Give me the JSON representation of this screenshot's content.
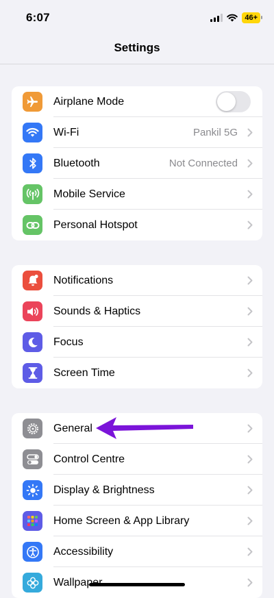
{
  "status_bar": {
    "time": "6:07",
    "battery": "46+"
  },
  "nav": {
    "title": "Settings"
  },
  "groups": [
    {
      "items": [
        {
          "label": "Airplane Mode",
          "icon": "airplane-icon",
          "color": "#f09a37",
          "toggle": false
        },
        {
          "label": "Wi-Fi",
          "icon": "wifi-icon",
          "color": "#3478f6",
          "value": "Pankil 5G"
        },
        {
          "label": "Bluetooth",
          "icon": "bluetooth-icon",
          "color": "#3478f6",
          "value": "Not Connected"
        },
        {
          "label": "Mobile Service",
          "icon": "antenna-icon",
          "color": "#65c466"
        },
        {
          "label": "Personal Hotspot",
          "icon": "link-icon",
          "color": "#65c466"
        }
      ]
    },
    {
      "items": [
        {
          "label": "Notifications",
          "icon": "bell-icon",
          "color": "#eb4e3d"
        },
        {
          "label": "Sounds & Haptics",
          "icon": "speaker-icon",
          "color": "#eb445a"
        },
        {
          "label": "Focus",
          "icon": "moon-icon",
          "color": "#5e5ce6"
        },
        {
          "label": "Screen Time",
          "icon": "hourglass-icon",
          "color": "#5e5ce6"
        }
      ]
    },
    {
      "items": [
        {
          "label": "General",
          "icon": "gear-icon",
          "color": "#8e8e93"
        },
        {
          "label": "Control Centre",
          "icon": "switches-icon",
          "color": "#8e8e93"
        },
        {
          "label": "Display & Brightness",
          "icon": "sun-icon",
          "color": "#3478f6"
        },
        {
          "label": "Home Screen & App Library",
          "icon": "app-grid-icon",
          "color": "#5e5ce6"
        },
        {
          "label": "Accessibility",
          "icon": "accessibility-icon",
          "color": "#3478f6"
        },
        {
          "label": "Wallpaper",
          "icon": "flower-icon",
          "color": "#35aadc"
        }
      ]
    }
  ],
  "annotation": {
    "arrow_color": "#7b14d9"
  }
}
